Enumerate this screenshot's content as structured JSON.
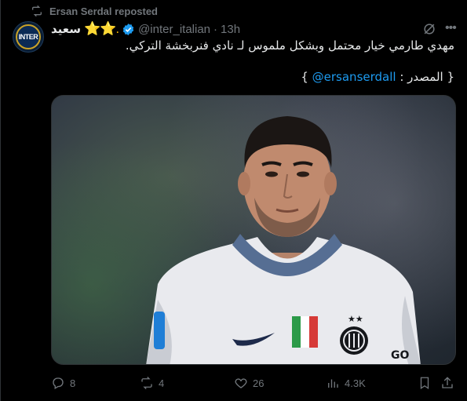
{
  "repost": {
    "label": "Ersan Serdal reposted",
    "icon": "repost-icon"
  },
  "author": {
    "display_name": "سعيد",
    "stars": "⭐⭐.",
    "handle": "@inter_italian",
    "separator": "·",
    "time": "13h",
    "avatar_text": "INTER"
  },
  "tweet": {
    "line1": "مهدي طارمي خيار محتمل وبشكل ملموس لـ نادي فنربخشة التركي.",
    "source_prefix": "{ المصدر : ",
    "source_link": "@ersanserdall",
    "source_suffix": " }"
  },
  "media": {
    "alt": "Photo of a footballer in a white Inter Milan away shirt"
  },
  "actions": {
    "replies": "8",
    "reposts": "4",
    "likes": "26",
    "views": "4.3K"
  },
  "colors": {
    "accent": "#1d9bf0",
    "muted": "#71767b",
    "text": "#e7e9ea",
    "background": "#000000"
  }
}
